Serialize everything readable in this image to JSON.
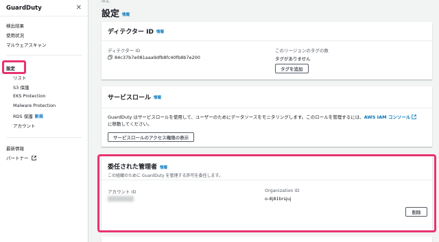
{
  "sidebar": {
    "title": "GuardDuty",
    "items": [
      {
        "label": "検出結果"
      },
      {
        "label": "使用状況"
      },
      {
        "label": "マルウェアスキャン"
      },
      {
        "label": "設定"
      },
      {
        "label": "リスト"
      },
      {
        "label": "S3 保護"
      },
      {
        "label": "EKS Protection"
      },
      {
        "label": "Malware Protection"
      },
      {
        "label": "RDS 保護"
      },
      {
        "label": "アカウント"
      },
      {
        "label": "最新情報"
      },
      {
        "label": "パートナー"
      }
    ],
    "new_badge": "新規"
  },
  "breadcrumb": "設定",
  "page": {
    "title": "設定",
    "info": "情報"
  },
  "detector": {
    "title": "ディテクター ID",
    "info": "情報",
    "id_label": "ディテクター ID",
    "id_value": "84c37b7e081aaa9dfb8fc40fb8b7e200",
    "tags_label": "このリージョンのタグの数",
    "tags_value": "タグがありません",
    "add_tag_button": "タグを追加"
  },
  "service_role": {
    "title": "サービスロール",
    "info": "情報",
    "description": "GuardDuty はサービスロールを使用して、ユーザーのためにデータソースをモニタリングします。このロールを管理するには、",
    "iam_link": "AWS IAM コンソール",
    "description_end": "に移動してください。",
    "view_button": "サービスロールのアクセス権限の表示"
  },
  "delegated_admin": {
    "title": "委任された管理者",
    "info": "情報",
    "subtitle": "この組織のために GuardDuty を管理する許可を委任します。",
    "account_id_label": "アカウント ID",
    "org_id_label": "Organization ID",
    "org_id_value": "o-8j81brsjuj",
    "delete_button": "削除"
  },
  "colors": {
    "highlight": "#e8336e",
    "link": "#0073bb"
  }
}
